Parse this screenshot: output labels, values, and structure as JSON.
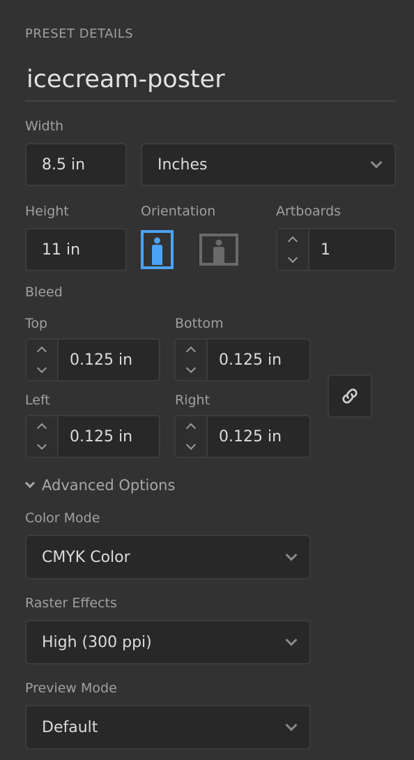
{
  "section_title": "PRESET DETAILS",
  "preset_name": "icecream-poster",
  "width": {
    "label": "Width",
    "value": "8.5 in",
    "units": "Inches"
  },
  "height": {
    "label": "Height",
    "value": "11 in"
  },
  "orientation": {
    "label": "Orientation",
    "selected": "portrait",
    "accent": "#4ba3f5"
  },
  "artboards": {
    "label": "Artboards",
    "value": "1"
  },
  "bleed": {
    "label": "Bleed",
    "top": {
      "label": "Top",
      "value": "0.125 in"
    },
    "bottom": {
      "label": "Bottom",
      "value": "0.125 in"
    },
    "left": {
      "label": "Left",
      "value": "0.125 in"
    },
    "right": {
      "label": "Right",
      "value": "0.125 in"
    },
    "link_icon": "link-icon"
  },
  "advanced": {
    "label": "Advanced Options",
    "color_mode": {
      "label": "Color Mode",
      "value": "CMYK Color"
    },
    "raster_effects": {
      "label": "Raster Effects",
      "value": "High (300 ppi)"
    },
    "preview_mode": {
      "label": "Preview Mode",
      "value": "Default"
    }
  }
}
